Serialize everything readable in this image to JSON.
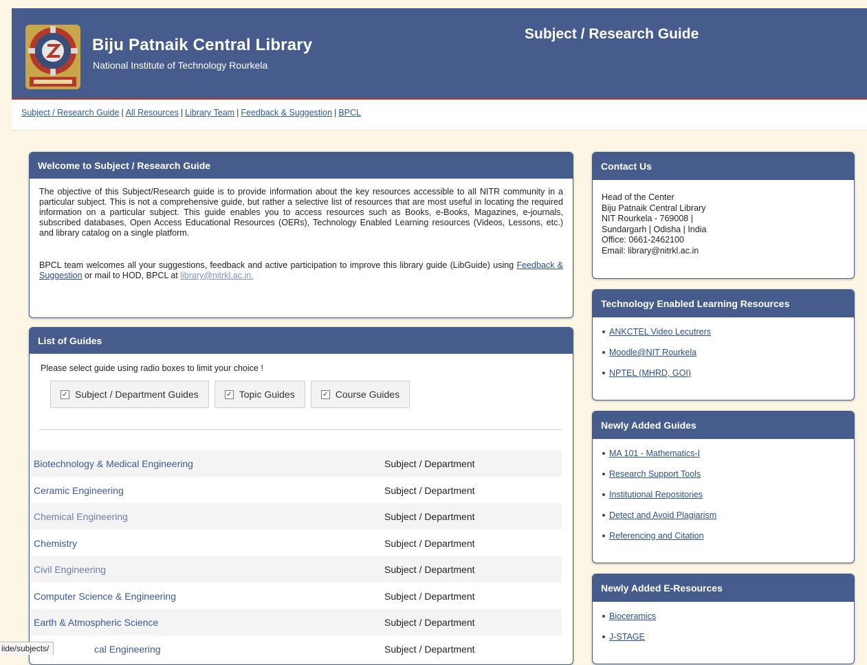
{
  "header": {
    "title": "Biju Patnaik Central Library",
    "subtitle": "National Institute of Technology  Rourkela",
    "page_title": "Subject / Research Guide"
  },
  "nav": {
    "links": [
      "Subject / Research Guide",
      "All Resources",
      "Library Team",
      "Feedback & Suggestion",
      "BPCL"
    ],
    "separator": "|"
  },
  "welcome": {
    "heading": "Welcome to Subject / Research Guide",
    "paragraph1": "The objective of this Subject/Research guide is to provide information about the key resources accessible to all NITR community in a particular subject. This is not a comprehensive guide, but rather a selective list of resources that are most useful in locating the required information on a particular subject. This guide enables you to access resources such as Books, e-Books, Magazines, e-journals, subscribed databases, Open Access Educational Resources (OERs), Technology Enabled Learning resources (Videos, Lessons, etc.) and library catalog on a single platform.",
    "paragraph2_text": "BPCL team welcomes all your suggestions, feedback and active participation to improve this library guide (LibGuide) using",
    "paragraph2_link1": "Feedback & Suggestion",
    "paragraph2_mid": "or mail to HOD, BPCL at",
    "paragraph2_link2": "library@nitrkl.ac.in."
  },
  "guides": {
    "heading": "List of Guides",
    "intro": "Please select guide using radio boxes to limit your choice !",
    "filters": [
      {
        "label": "Subject / Department Guides",
        "checked": true
      },
      {
        "label": "Topic Guides",
        "checked": true
      },
      {
        "label": "Course Guides",
        "checked": true
      }
    ],
    "check_glyph": "✓",
    "rows": [
      {
        "name": "Biotechnology & Medical Engineering",
        "type": "Subject / Department"
      },
      {
        "name": "Ceramic Engineering",
        "type": "Subject / Department"
      },
      {
        "name": "Chemical Engineering",
        "type": "Subject / Department"
      },
      {
        "name": "Chemistry",
        "type": "Subject / Department"
      },
      {
        "name": "Civil Engineering",
        "type": "Subject / Department"
      },
      {
        "name": "Computer Science & Engineering",
        "type": "Subject / Department"
      },
      {
        "name": "Earth & Atmospheric Science",
        "type": "Subject / Department"
      },
      {
        "name": "cal Engineering",
        "type": "Subject / Department"
      }
    ]
  },
  "contact": {
    "heading": "Contact Us",
    "lines": [
      "Head of the Center",
      "Biju Patnaik Central Library",
      "NIT Rourkela - 769008 |",
      "Sundargarh | Odisha | India",
      "Office: 0661-2462100",
      "Email: library@nitrkl.ac.in"
    ]
  },
  "tel": {
    "heading": "Technology Enabled Learning Resources",
    "items": [
      "ANKCTEL Video Lecutrers",
      "Moodle@NIT Rourkela",
      "NPTEL (MHRD, GOI)"
    ]
  },
  "new_guides": {
    "heading": "Newly Added Guides",
    "items": [
      "MA 101 - Mathematics-I",
      "Research Support Tools",
      "Institutional Repositories",
      "Detect and Avoid Plagiarism",
      "Referencing and Citation"
    ]
  },
  "new_eresources": {
    "heading": "Newly Added E-Resources",
    "items": [
      "Bioceramics",
      "J-STAGE"
    ]
  },
  "status_bar": {
    "url": "iide/subjects/"
  },
  "colors": {
    "header_bg": "#465c8d",
    "page_bg": "#fdf6e4",
    "accent_red": "#b33a2a",
    "link": "#2a4f8a"
  }
}
